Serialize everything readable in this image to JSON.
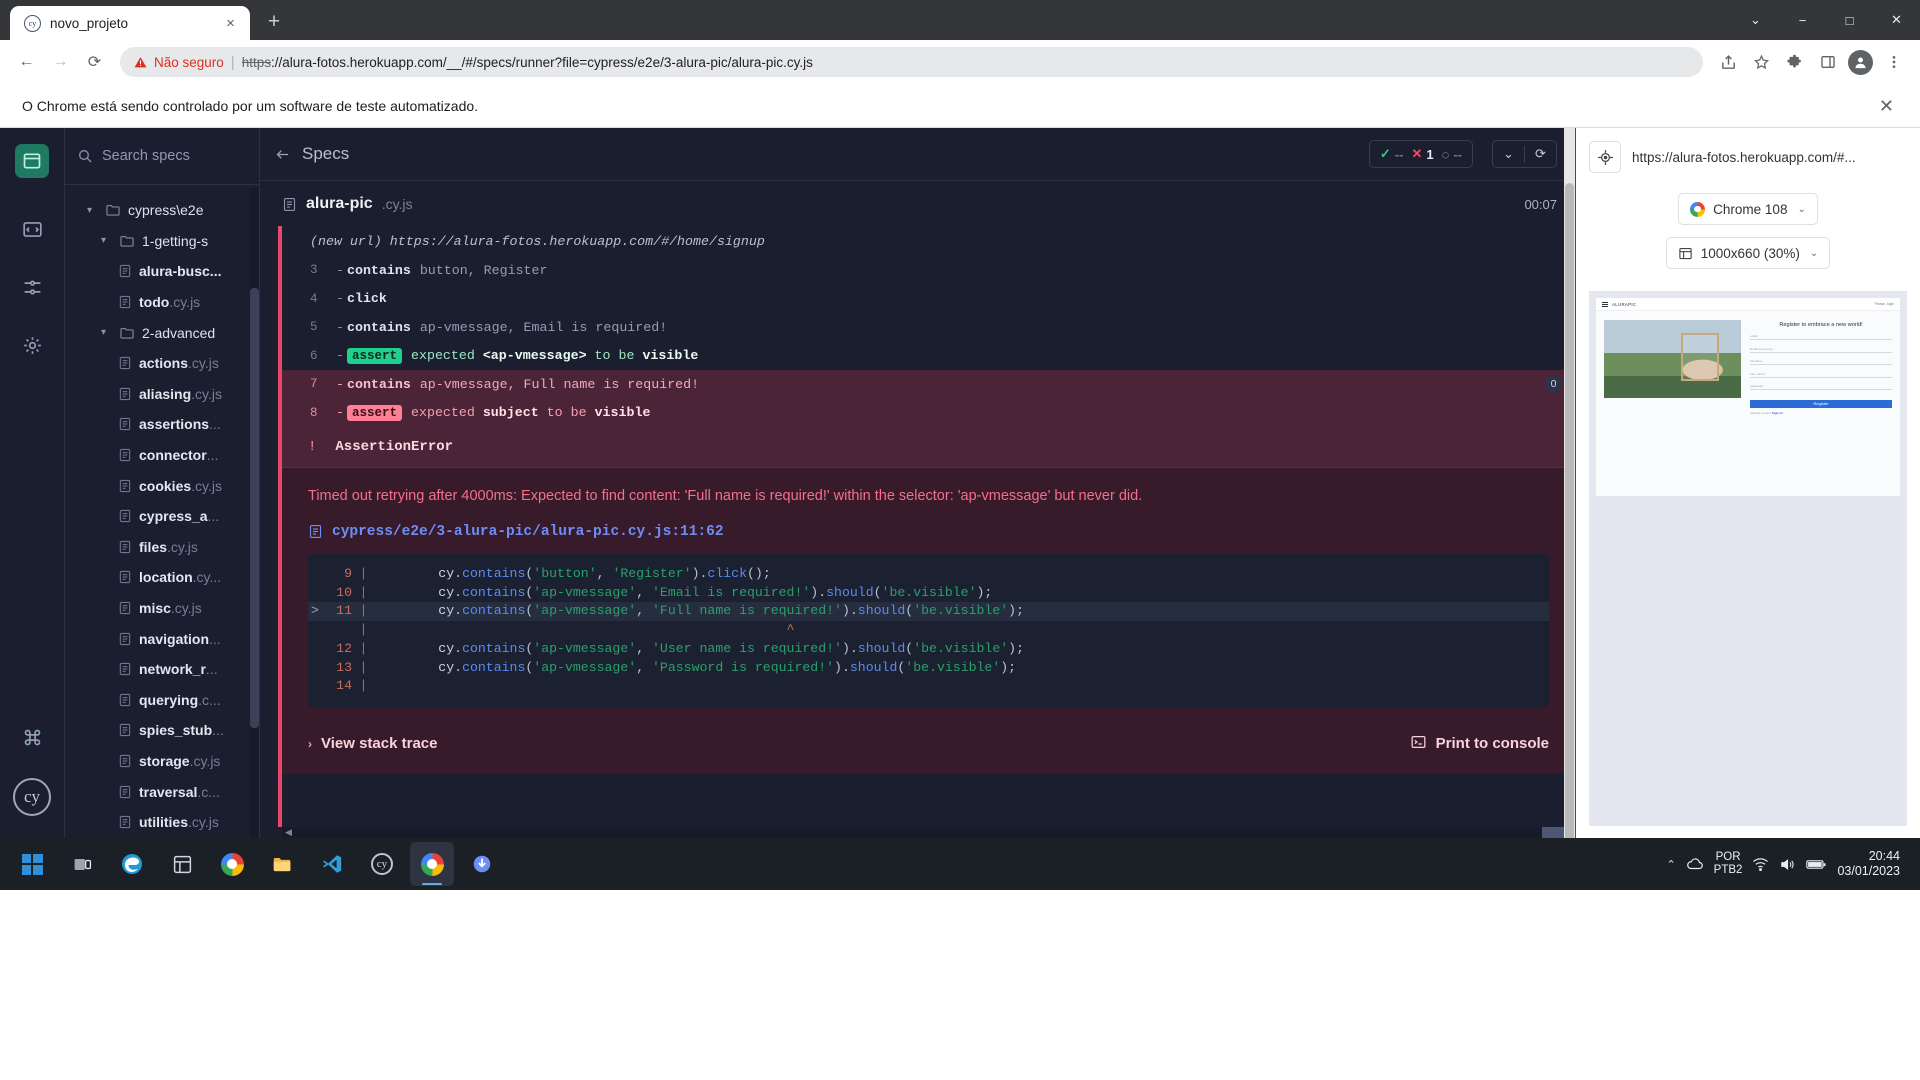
{
  "browser": {
    "tab": {
      "title": "novo_projeto",
      "favicon": "cypress-icon",
      "close": "×"
    },
    "new_tab": "+",
    "window_controls": {
      "minimize": "−",
      "maximize": "□",
      "close": "✕",
      "chevron": "⌄"
    },
    "nav": {
      "back": "←",
      "forward": "→",
      "reload": "⟳"
    },
    "omnibox": {
      "not_secure": "Não seguro",
      "separator": "|",
      "url_scheme": "https",
      "url_rest": "://alura-fotos.herokuapp.com/__/#/specs/runner?file=cypress/e2e/3-alura-pic/alura-pic.cy.js"
    },
    "toolbar_icons": [
      "share-icon",
      "bookmark-star-icon",
      "extensions-puzzle-icon",
      "sidepanel-icon",
      "profile-avatar-icon",
      "chrome-menu-icon"
    ],
    "infobar": {
      "text": "O Chrome está sendo controlado por um software de teste automatizado.",
      "close": "✕"
    }
  },
  "cypress": {
    "rail": [
      "cypress-logo",
      "code-specs-icon",
      "runs-icon",
      "settings-gear-icon",
      "command-palette-icon",
      "cypress-badge"
    ],
    "sidebar": {
      "search_placeholder": "Search specs",
      "add_button": "+",
      "tree": [
        {
          "type": "folder",
          "depth": 0,
          "name": "cypress\\e2e",
          "expanded": true
        },
        {
          "type": "folder",
          "depth": 1,
          "name": "1-getting-s",
          "expanded": true
        },
        {
          "type": "file",
          "depth": 2,
          "name": "alura-busc...",
          "ext": ""
        },
        {
          "type": "file",
          "depth": 2,
          "name": "todo",
          "ext": ".cy.js"
        },
        {
          "type": "folder",
          "depth": 1,
          "name": "2-advanced",
          "expanded": true
        },
        {
          "type": "file",
          "depth": 2,
          "name": "actions",
          "ext": ".cy.js"
        },
        {
          "type": "file",
          "depth": 2,
          "name": "aliasing",
          "ext": ".cy.js"
        },
        {
          "type": "file",
          "depth": 2,
          "name": "assertions",
          "ext": "..."
        },
        {
          "type": "file",
          "depth": 2,
          "name": "connector",
          "ext": "..."
        },
        {
          "type": "file",
          "depth": 2,
          "name": "cookies",
          "ext": ".cy.js"
        },
        {
          "type": "file",
          "depth": 2,
          "name": "cypress_a",
          "ext": "..."
        },
        {
          "type": "file",
          "depth": 2,
          "name": "files",
          "ext": ".cy.js"
        },
        {
          "type": "file",
          "depth": 2,
          "name": "location",
          "ext": ".cy..."
        },
        {
          "type": "file",
          "depth": 2,
          "name": "misc",
          "ext": ".cy.js"
        },
        {
          "type": "file",
          "depth": 2,
          "name": "navigation",
          "ext": "..."
        },
        {
          "type": "file",
          "depth": 2,
          "name": "network_r",
          "ext": "..."
        },
        {
          "type": "file",
          "depth": 2,
          "name": "querying",
          "ext": ".c..."
        },
        {
          "type": "file",
          "depth": 2,
          "name": "spies_stub",
          "ext": "..."
        },
        {
          "type": "file",
          "depth": 2,
          "name": "storage",
          "ext": ".cy.js"
        },
        {
          "type": "file",
          "depth": 2,
          "name": "traversal",
          "ext": ".c..."
        },
        {
          "type": "file",
          "depth": 2,
          "name": "utilities",
          "ext": ".cy.js"
        }
      ]
    },
    "reporter": {
      "back_label": "Specs",
      "stats": {
        "passed_icon": "✓",
        "passed_value": "--",
        "failed_icon": "✕",
        "failed_value": "1",
        "pending_icon": "◌",
        "pending_value": "--"
      },
      "controls": {
        "chevron": "⌄",
        "restart": "⟳"
      },
      "spec": {
        "name": "alura-pic",
        "ext": ".cy.js",
        "timer": "00:07"
      },
      "commands": [
        {
          "num": "",
          "kind": "url",
          "text": "(new url)  https://alura-fotos.herokuapp.com/#/home/signup"
        },
        {
          "num": "3",
          "kind": "cmd",
          "name": "contains",
          "args": "button, Register"
        },
        {
          "num": "4",
          "kind": "cmd",
          "name": "click",
          "args": ""
        },
        {
          "num": "5",
          "kind": "cmd",
          "name": "contains",
          "args": "ap-vmessage, Email is required!"
        },
        {
          "num": "6",
          "kind": "assert",
          "state": "pass",
          "badge": "assert",
          "text_pre": "expected",
          "text_b1": "<ap-vmessage>",
          "text_mid": "to be",
          "text_b2": "visible"
        },
        {
          "num": "7",
          "kind": "cmd",
          "state": "fail",
          "name": "contains",
          "args": "ap-vmessage, Full name is required!",
          "badge_count": "0"
        },
        {
          "num": "8",
          "kind": "assert",
          "state": "fail",
          "badge": "assert",
          "text_pre": "expected",
          "text_b1": "subject",
          "text_mid": "to be",
          "text_b2": "visible"
        }
      ],
      "error": {
        "bang": "!",
        "type": "AssertionError",
        "message": "Timed out retrying after 4000ms: Expected to find content: 'Full name is required!' within the selector: 'ap-vmessage' but never did.",
        "file_path": "cypress/e2e/3-alura-pic/alura-pic.cy.js:11:62",
        "code_lines": [
          {
            "no": "9",
            "caret": "",
            "highlight": false,
            "tokens": [
              {
                "t": "        cy",
                "c": "plain"
              },
              {
                "t": ".",
                "c": "punc"
              },
              {
                "t": "contains",
                "c": "prop"
              },
              {
                "t": "(",
                "c": "punc"
              },
              {
                "t": "'button'",
                "c": "str"
              },
              {
                "t": ", ",
                "c": "punc"
              },
              {
                "t": "'Register'",
                "c": "str"
              },
              {
                "t": ")",
                "c": "punc"
              },
              {
                "t": ".",
                "c": "punc"
              },
              {
                "t": "click",
                "c": "prop"
              },
              {
                "t": "();",
                "c": "punc"
              }
            ]
          },
          {
            "no": "10",
            "caret": "",
            "highlight": false,
            "tokens": [
              {
                "t": "        cy",
                "c": "plain"
              },
              {
                "t": ".",
                "c": "punc"
              },
              {
                "t": "contains",
                "c": "prop"
              },
              {
                "t": "(",
                "c": "punc"
              },
              {
                "t": "'ap-vmessage'",
                "c": "str"
              },
              {
                "t": ", ",
                "c": "punc"
              },
              {
                "t": "'Email is required!'",
                "c": "str"
              },
              {
                "t": ")",
                "c": "punc"
              },
              {
                "t": ".",
                "c": "punc"
              },
              {
                "t": "should",
                "c": "prop"
              },
              {
                "t": "(",
                "c": "punc"
              },
              {
                "t": "'be.visible'",
                "c": "str"
              },
              {
                "t": ");",
                "c": "punc"
              }
            ]
          },
          {
            "no": "11",
            "caret": ">",
            "highlight": true,
            "tokens": [
              {
                "t": "        cy",
                "c": "plain"
              },
              {
                "t": ".",
                "c": "punc"
              },
              {
                "t": "contains",
                "c": "prop"
              },
              {
                "t": "(",
                "c": "punc"
              },
              {
                "t": "'ap-vmessage'",
                "c": "str"
              },
              {
                "t": ", ",
                "c": "punc"
              },
              {
                "t": "'Full name is required!'",
                "c": "str"
              },
              {
                "t": ")",
                "c": "punc"
              },
              {
                "t": ".",
                "c": "punc"
              },
              {
                "t": "should",
                "c": "prop"
              },
              {
                "t": "(",
                "c": "punc"
              },
              {
                "t": "'be.visible'",
                "c": "str"
              },
              {
                "t": ");",
                "c": "punc"
              }
            ]
          },
          {
            "no": "",
            "caret": "",
            "highlight": false,
            "marker": true,
            "tokens": []
          },
          {
            "no": "12",
            "caret": "",
            "highlight": false,
            "tokens": [
              {
                "t": "        cy",
                "c": "plain"
              },
              {
                "t": ".",
                "c": "punc"
              },
              {
                "t": "contains",
                "c": "prop"
              },
              {
                "t": "(",
                "c": "punc"
              },
              {
                "t": "'ap-vmessage'",
                "c": "str"
              },
              {
                "t": ", ",
                "c": "punc"
              },
              {
                "t": "'User name is required!'",
                "c": "str"
              },
              {
                "t": ")",
                "c": "punc"
              },
              {
                "t": ".",
                "c": "punc"
              },
              {
                "t": "should",
                "c": "prop"
              },
              {
                "t": "(",
                "c": "punc"
              },
              {
                "t": "'be.visible'",
                "c": "str"
              },
              {
                "t": ");",
                "c": "punc"
              }
            ]
          },
          {
            "no": "13",
            "caret": "",
            "highlight": false,
            "tokens": [
              {
                "t": "        cy",
                "c": "plain"
              },
              {
                "t": ".",
                "c": "punc"
              },
              {
                "t": "contains",
                "c": "prop"
              },
              {
                "t": "(",
                "c": "punc"
              },
              {
                "t": "'ap-vmessage'",
                "c": "str"
              },
              {
                "t": ", ",
                "c": "punc"
              },
              {
                "t": "'Password is required!'",
                "c": "str"
              },
              {
                "t": ")",
                "c": "punc"
              },
              {
                "t": ".",
                "c": "punc"
              },
              {
                "t": "should",
                "c": "prop"
              },
              {
                "t": "(",
                "c": "punc"
              },
              {
                "t": "'be.visible'",
                "c": "str"
              },
              {
                "t": ");",
                "c": "punc"
              }
            ]
          },
          {
            "no": "14",
            "caret": "",
            "highlight": false,
            "tokens": []
          }
        ],
        "stack_trace_label": "View stack trace",
        "stack_trace_chevron": "›",
        "print_console_label": "Print to console"
      }
    },
    "preview": {
      "selector_icon": "selector-playground-icon",
      "url": "https://alura-fotos.herokuapp.com/#...",
      "browser_pill": "Chrome 108",
      "viewport_pill": "1000x660 (30%)",
      "chevron": "⌄",
      "app": {
        "brand": "ALURAPIC",
        "login_link": "Please, login",
        "form_title": "Register to embrace a new world!",
        "fields": [
          "email",
          "Email (recovery)",
          "full name",
          "user name",
          "password"
        ],
        "submit": "Register",
        "footnote_pre": "Already a user? ",
        "footnote_link": "Sign in!"
      }
    }
  },
  "taskbar": {
    "apps": [
      "start-windows-icon",
      "task-view-icon",
      "edge-icon",
      "store-icon",
      "chrome-icon",
      "file-explorer-icon",
      "vscode-icon",
      "cypress-icon",
      "chrome-active-icon",
      "installer-icon"
    ],
    "tray": {
      "chevron": "⌃",
      "onedrive": "cloud-icon",
      "network": "wifi-icon",
      "volume": "speaker-icon",
      "battery": "battery-icon"
    },
    "language": {
      "line1": "POR",
      "line2": "PTB2"
    },
    "clock": {
      "time": "20:44",
      "date": "03/01/2023"
    }
  }
}
